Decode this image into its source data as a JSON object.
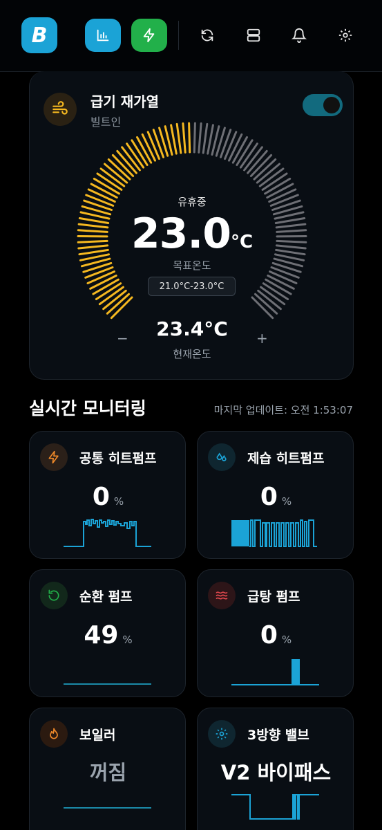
{
  "header": {
    "logo_letter": "B",
    "buttons": [
      {
        "name": "chart-icon",
        "color": "#1ba3d6"
      },
      {
        "name": "bolt-icon",
        "color": "#22b04a"
      }
    ],
    "icons": [
      "refresh-icon",
      "server-icon",
      "bell-icon",
      "gear-icon"
    ]
  },
  "main_card": {
    "title": "급기 재가열",
    "subtitle": "빌트인",
    "toggle_on": true,
    "status": "유휴중",
    "target_value": "23.0",
    "target_unit": "°C",
    "target_label": "목표온도",
    "range": "21.0°C-23.0°C",
    "current_value": "23.4°C",
    "current_label": "현재온도",
    "minus": "−",
    "plus": "+",
    "gauge_fill": 0.5,
    "colors": {
      "active": "#f5b820",
      "inactive": "#6e6f75"
    }
  },
  "monitor": {
    "title": "실시간 모니터링",
    "last_update": "마지막 업데이트: 오전 1:53:07",
    "cards": [
      {
        "title": "공통 히트펌프",
        "value": "0",
        "unit": "%",
        "icon": "bolt-icon",
        "icon_color": "#f08a2a"
      },
      {
        "title": "제습 히트펌프",
        "value": "0",
        "unit": "%",
        "icon": "droplets-icon",
        "icon_color": "#1ba3d6"
      },
      {
        "title": "순환 펌프",
        "value": "49",
        "unit": "%",
        "icon": "rotate-icon",
        "icon_color": "#22b04a"
      },
      {
        "title": "급탕 펌프",
        "value": "0",
        "unit": "%",
        "icon": "waves-icon",
        "icon_color": "#e0484e"
      },
      {
        "title": "보일러",
        "text": "꺼짐",
        "icon": "flame-icon",
        "icon_color": "#f08a2a"
      },
      {
        "title": "3방향 밸브",
        "text": "V2 바이패스",
        "icon": "gear-icon",
        "icon_color": "#1ba3d6"
      }
    ]
  }
}
